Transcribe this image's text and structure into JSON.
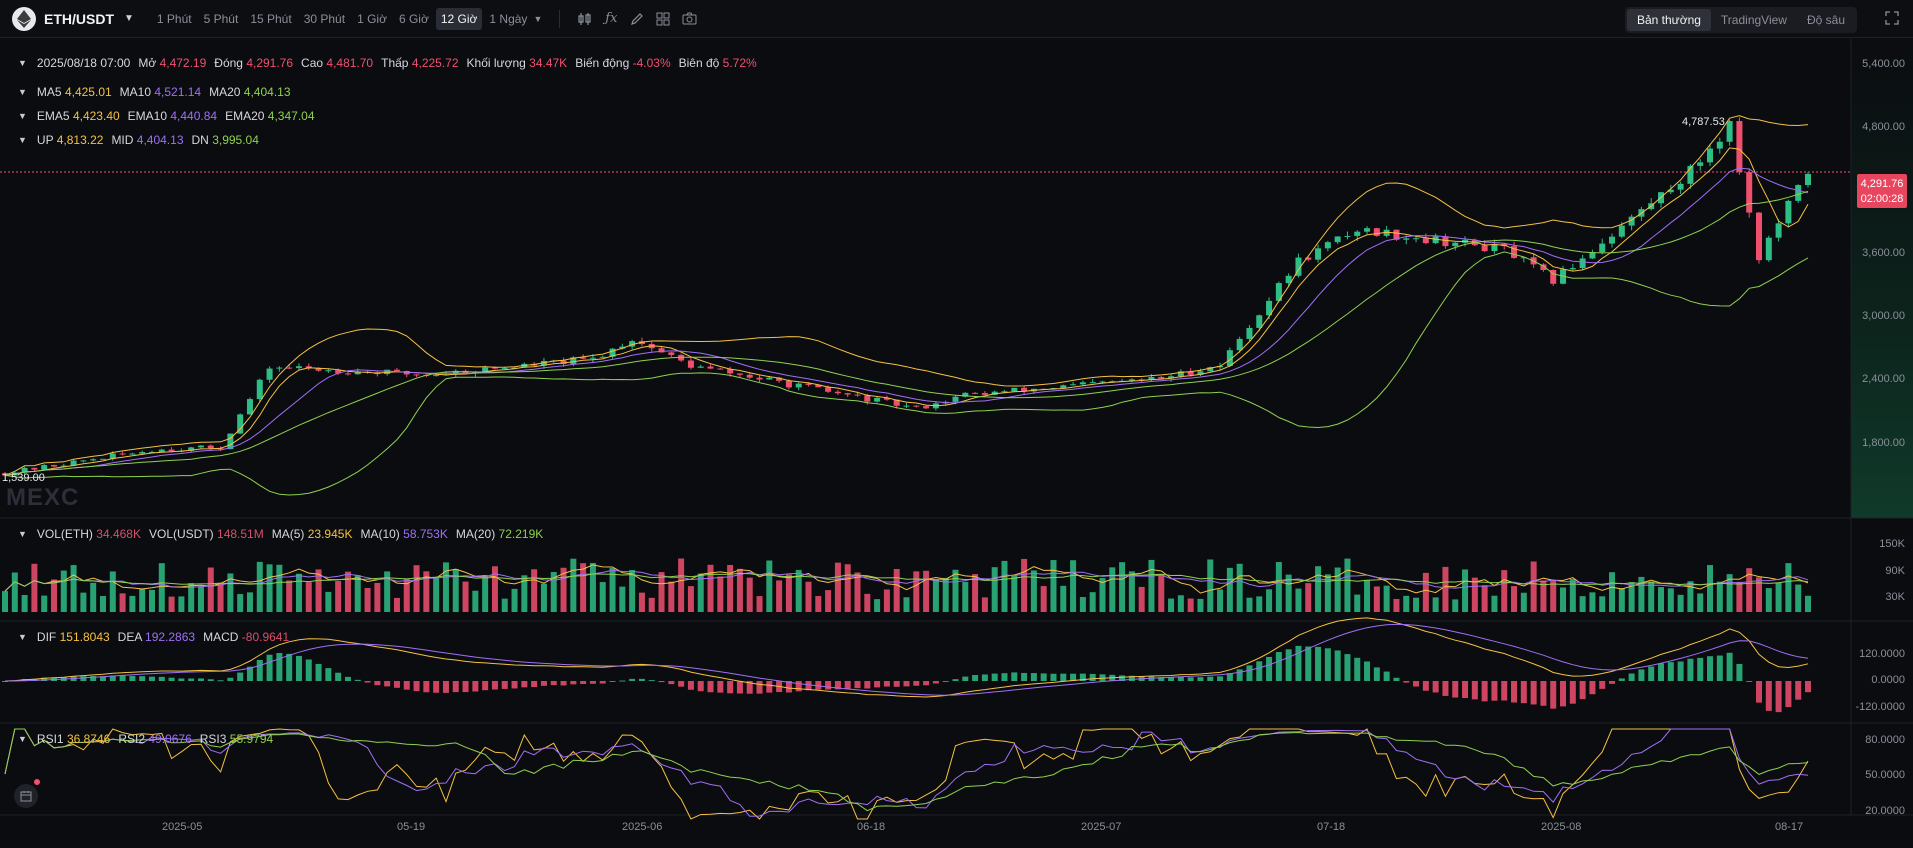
{
  "toolbar": {
    "symbol": "ETH/USDT",
    "intervals": [
      "1 Phút",
      "5 Phút",
      "15 Phút",
      "30 Phút",
      "1 Giờ",
      "6 Giờ",
      "12 Giờ"
    ],
    "active_interval": "12 Giờ",
    "more_interval": "1 Ngày",
    "views": [
      "Bản thường",
      "TradingView",
      "Độ sâu"
    ],
    "active_view": "Bản thường"
  },
  "ohlc": {
    "date": "2025/08/18 07:00",
    "open_label": "Mở",
    "open": "4,472.19",
    "close_label": "Đóng",
    "close": "4,291.76",
    "high_label": "Cao",
    "high": "4,481.70",
    "low_label": "Thấp",
    "low": "4,225.72",
    "volume_label": "Khối lượng",
    "volume": "34.47K",
    "change_label": "Biến động",
    "change": "-4.03%",
    "amplitude_label": "Biên độ",
    "amplitude": "5.72%"
  },
  "ma": {
    "ma5_label": "MA5",
    "ma5": "4,425.01",
    "ma10_label": "MA10",
    "ma10": "4,521.14",
    "ma20_label": "MA20",
    "ma20": "4,404.13"
  },
  "ema": {
    "ema5_label": "EMA5",
    "ema5": "4,423.40",
    "ema10_label": "EMA10",
    "ema10": "4,440.84",
    "ema20_label": "EMA20",
    "ema20": "4,347.04"
  },
  "boll": {
    "up_label": "UP",
    "up": "4,813.22",
    "mid_label": "MID",
    "mid": "4,404.13",
    "dn_label": "DN",
    "dn": "3,995.04"
  },
  "vol": {
    "eth_label": "VOL(ETH)",
    "eth": "34.468K",
    "usdt_label": "VOL(USDT)",
    "usdt": "148.51M",
    "ma5_label": "MA(5)",
    "ma5": "23.945K",
    "ma10_label": "MA(10)",
    "ma10": "58.753K",
    "ma20_label": "MA(20)",
    "ma20": "72.219K"
  },
  "macd": {
    "dif_label": "DIF",
    "dif": "151.8043",
    "dea_label": "DEA",
    "dea": "192.2863",
    "macd_label": "MACD",
    "macd": "-80.9641"
  },
  "rsi": {
    "rsi1_label": "RSI1",
    "rsi1": "36.8746",
    "rsi2_label": "RSI2",
    "rsi2": "49.0676",
    "rsi3_label": "RSI3",
    "rsi3": "55.9794"
  },
  "price_axis": [
    "5,400.00",
    "4,800.00",
    "3,600.00",
    "3,000.00",
    "2,400.00",
    "1,800.00"
  ],
  "last_price": "4,291.76",
  "countdown": "02:00:28",
  "high_marker": "4,787.53",
  "low_marker": "1,539.00",
  "vol_axis": [
    "150K",
    "90K",
    "30K"
  ],
  "macd_axis": [
    "120.0000",
    "0.0000",
    "-120.0000"
  ],
  "rsi_axis": [
    "80.0000",
    "50.0000",
    "20.0000"
  ],
  "x_axis": [
    "2025-05",
    "05-19",
    "2025-06",
    "06-18",
    "2025-07",
    "07-18",
    "2025-08",
    "08-17"
  ],
  "watermark": "MEXC",
  "colors": {
    "up": "#2ebd85",
    "down": "#f0506e",
    "ma5": "#f5c142",
    "ma10": "#9f70f5",
    "ma20": "#8fd14f",
    "background": "#0b0c10"
  },
  "chart_data": {
    "type": "candlestick",
    "interval": "12 Giờ",
    "keypoints": [
      {
        "x": "2025-05",
        "y": 1810
      },
      {
        "x": "05-19",
        "y": 2480
      },
      {
        "x": "2025-06",
        "y": 2560
      },
      {
        "x": "06-18",
        "y": 2300
      },
      {
        "x": "2025-07",
        "y": 2570
      },
      {
        "x": "07-18",
        "y": 3600
      },
      {
        "x": "2025-08",
        "y": 3530
      },
      {
        "x": "08-17",
        "y": 4291.76
      }
    ],
    "ylim": [
      1539,
      5400
    ],
    "y_ticks": [
      1800,
      2400,
      3000,
      3600,
      4800,
      5400
    ]
  }
}
